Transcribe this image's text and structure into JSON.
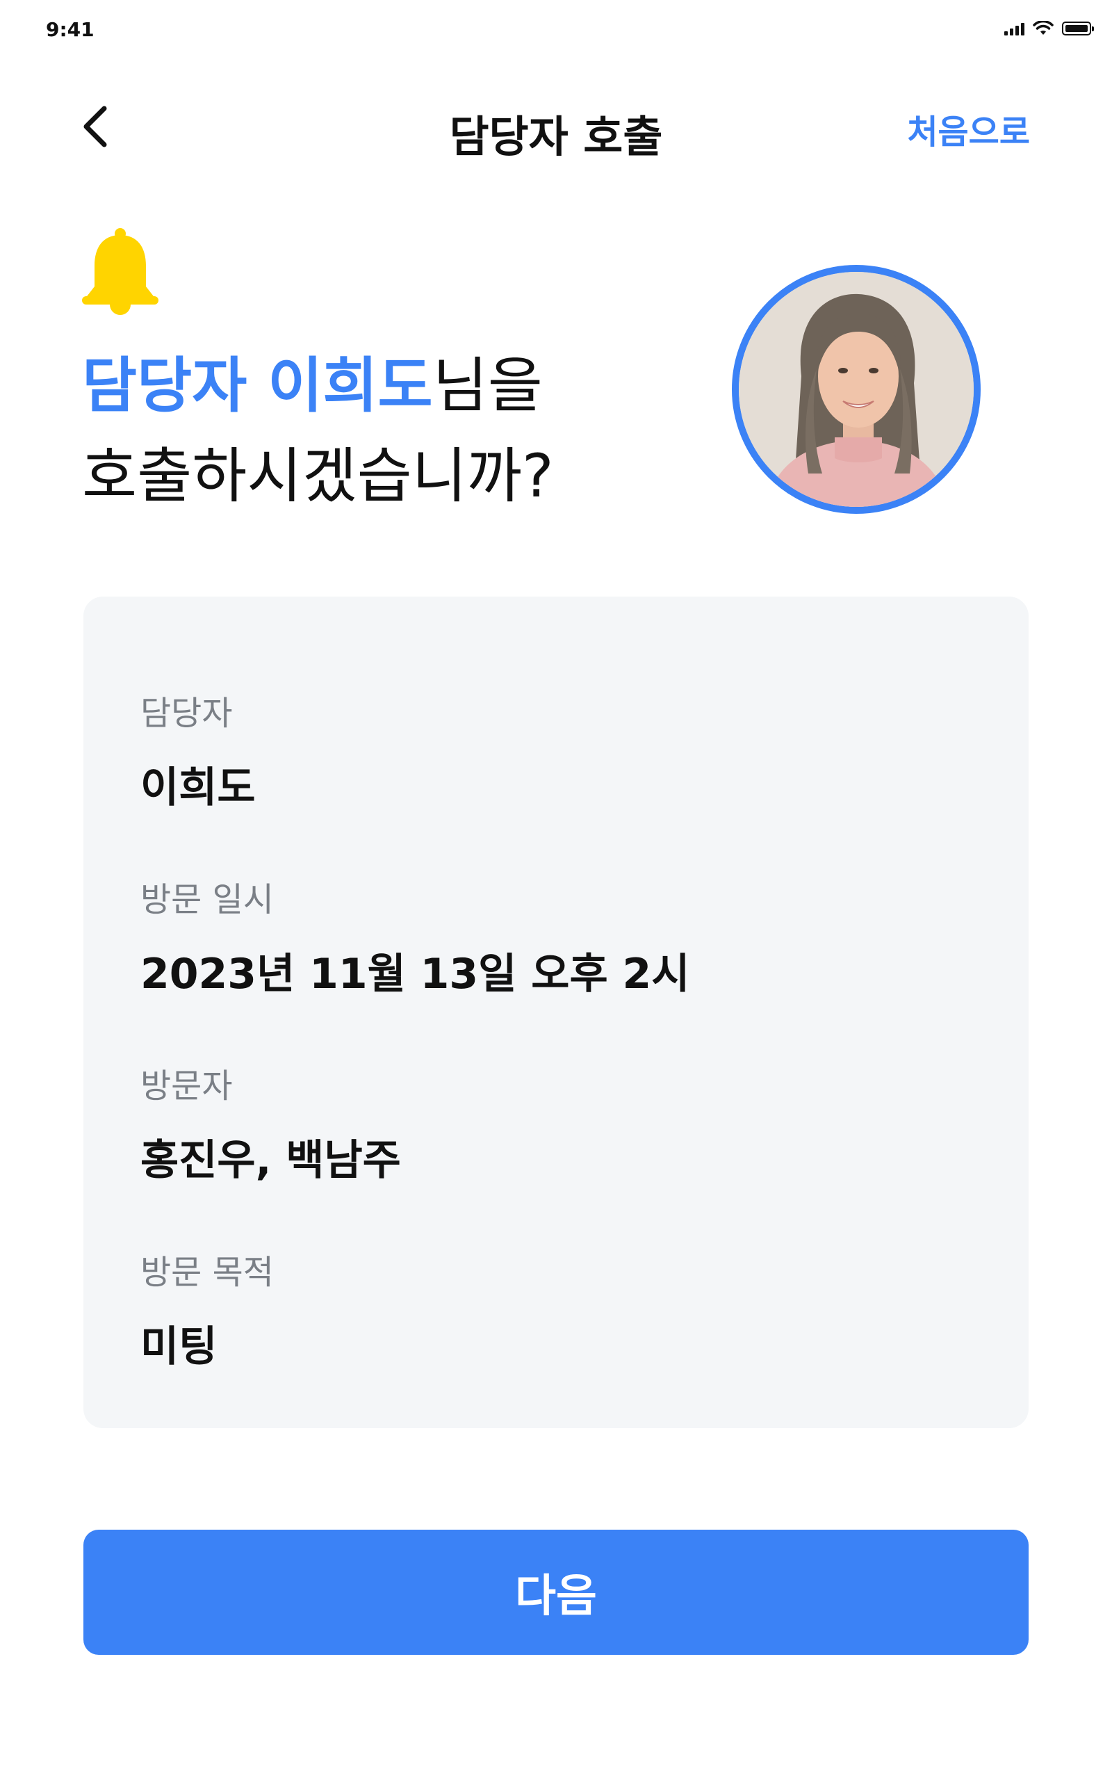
{
  "status_bar": {
    "time": "9:41"
  },
  "nav": {
    "title": "담당자 호출",
    "home_label": "처음으로"
  },
  "hero": {
    "accent_text": "담당자 이희도",
    "suffix_text": "님을",
    "line2": "호출하시겠습니까?",
    "bell_icon": "bell-icon",
    "bell_color": "#FFD400",
    "avatar_icon": "profile-photo",
    "avatar_border_color": "#3B82F6"
  },
  "details": {
    "fields": [
      {
        "label": "담당자",
        "value": "이희도"
      },
      {
        "label": "방문 일시",
        "value": "2023년 11월 13일 오후 2시"
      },
      {
        "label": "방문자",
        "value": "홍진우, 백남주"
      },
      {
        "label": "방문 목적",
        "value": "미팅"
      }
    ]
  },
  "actions": {
    "next_label": "다음"
  },
  "colors": {
    "accent": "#3B82F6",
    "card_bg": "#F4F6F8",
    "label": "#7A7F86",
    "text": "#111111"
  }
}
